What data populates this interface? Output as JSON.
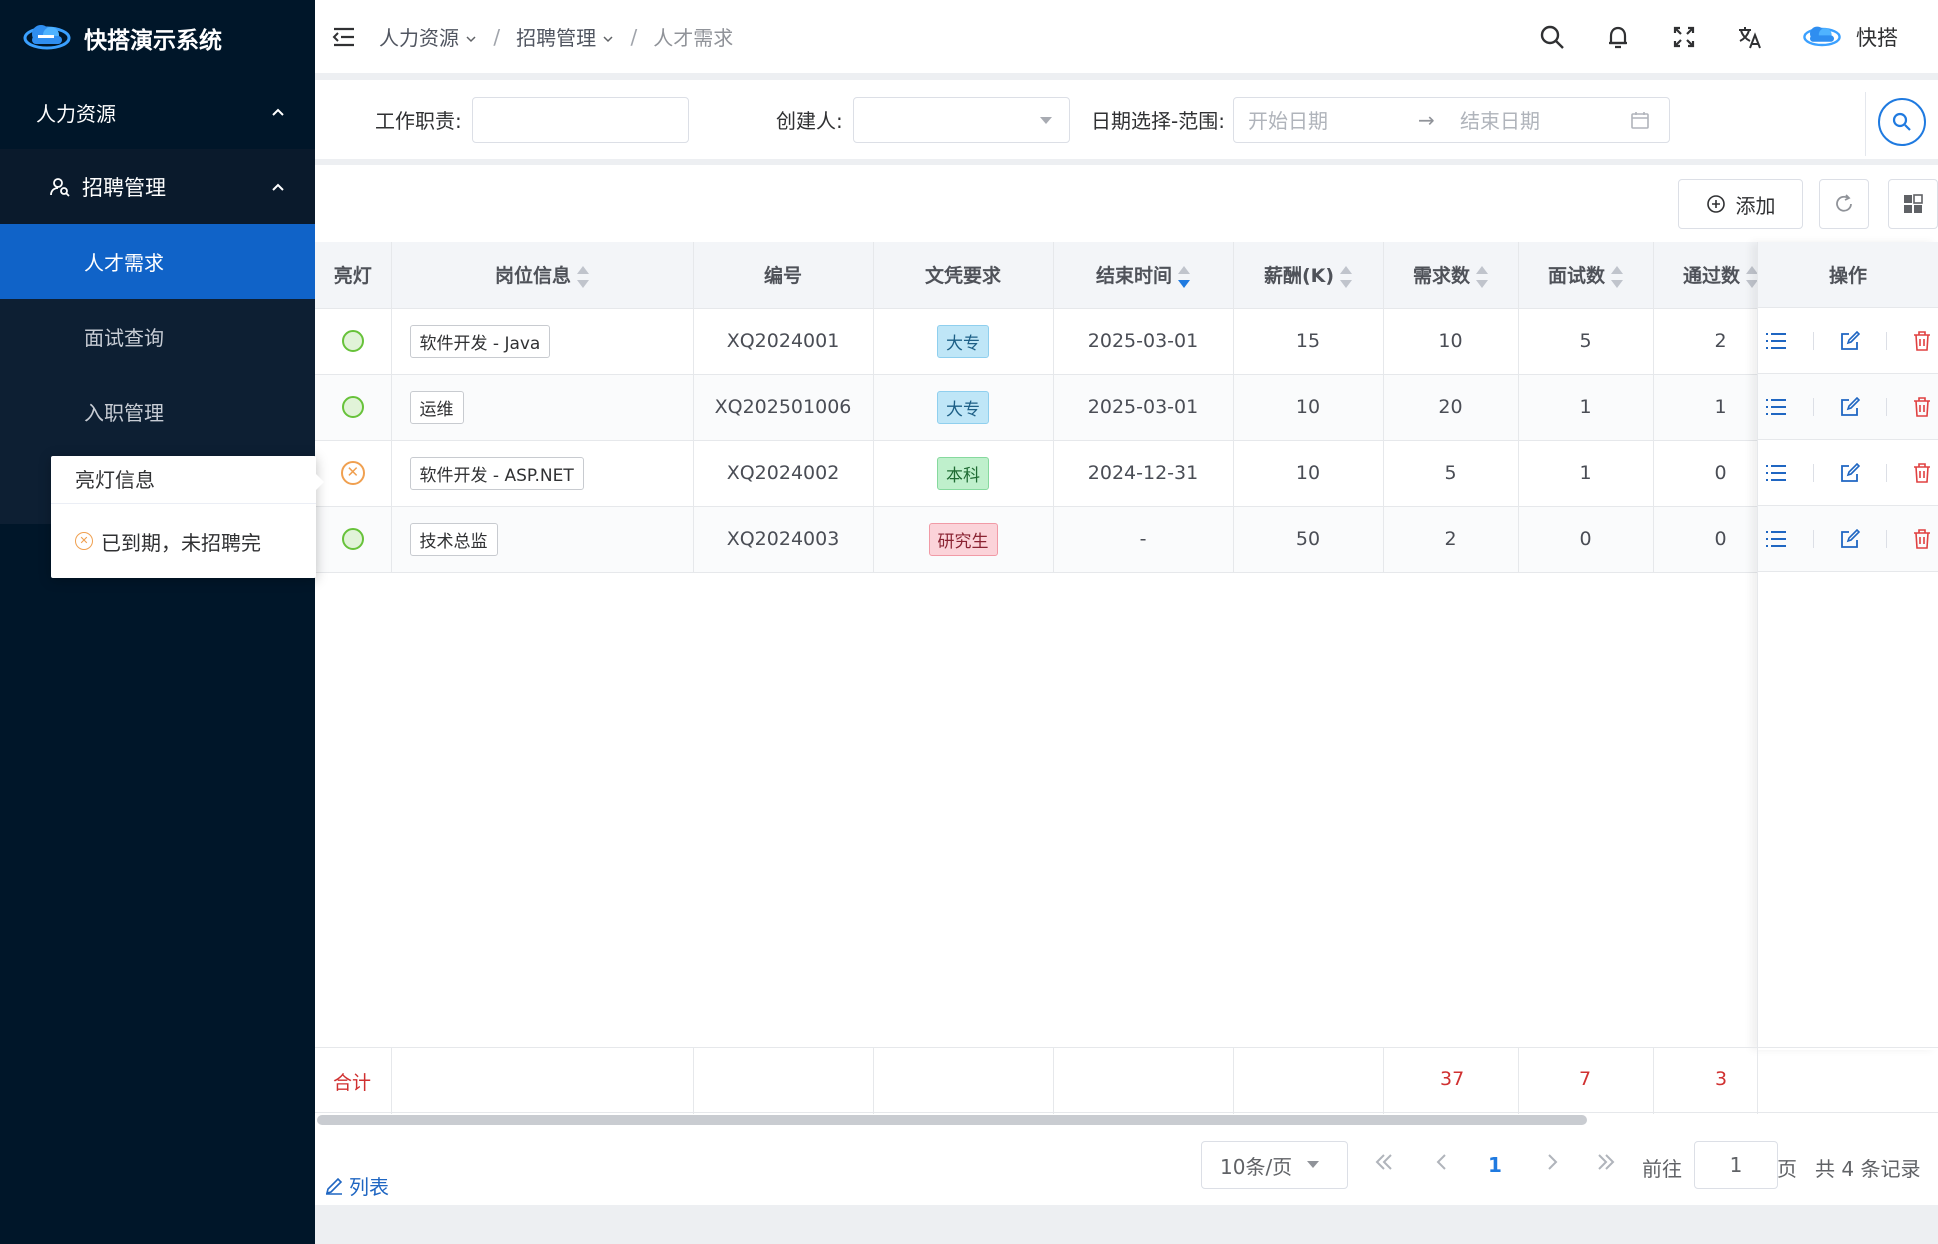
{
  "app": {
    "name": "快搭演示系统"
  },
  "sidebar": {
    "group": "人力资源",
    "submenu": "招聘管理",
    "items": [
      {
        "label": "人才需求",
        "active": true
      },
      {
        "label": "面试查询",
        "active": false
      },
      {
        "label": "入职管理",
        "active": false
      }
    ]
  },
  "breadcrumb": [
    {
      "label": "人力资源",
      "dropdown": true
    },
    {
      "label": "招聘管理",
      "dropdown": true
    },
    {
      "label": "人才需求",
      "dropdown": false
    }
  ],
  "breadcrumb_sep": "/",
  "header": {
    "user": "快搭"
  },
  "filters": {
    "duty_label": "工作职责:",
    "duty_value": "",
    "creator_label": "创建人:",
    "creator_value": "",
    "date_label": "日期选择-范围:",
    "date_start_placeholder": "开始日期",
    "date_arrow": "→",
    "date_end_placeholder": "结束日期"
  },
  "toolbar": {
    "add_label": "添加"
  },
  "table": {
    "columns": [
      "亮灯",
      "岗位信息",
      "编号",
      "文凭要求",
      "结束时间",
      "薪酬(K)",
      "需求数",
      "面试数",
      "通过数",
      "操作"
    ],
    "rows": [
      {
        "light": "ok",
        "position": "软件开发 - Java",
        "code": "XQ2024001",
        "edu": "大专",
        "end": "2025-03-01",
        "salary": "15",
        "demand": "10",
        "interview": "5",
        "passed": "2"
      },
      {
        "light": "ok",
        "position": "运维",
        "code": "XQ202501006",
        "edu": "大专",
        "end": "2025-03-01",
        "salary": "10",
        "demand": "20",
        "interview": "1",
        "passed": "1"
      },
      {
        "light": "expired",
        "position": "软件开发 - ASP.NET",
        "code": "XQ2024002",
        "edu": "本科",
        "end": "2024-12-31",
        "salary": "10",
        "demand": "5",
        "interview": "1",
        "passed": "0"
      },
      {
        "light": "ok",
        "position": "技术总监",
        "code": "XQ2024003",
        "edu": "研究生",
        "end": "-",
        "salary": "50",
        "demand": "2",
        "interview": "0",
        "passed": "0"
      }
    ],
    "edu_colors": {
      "大专": "#bfe6f7",
      "本科": "#bff0cc",
      "研究生": "#fbd3d9"
    },
    "summary": {
      "label": "合计",
      "demand": "37",
      "interview": "7",
      "passed": "3"
    }
  },
  "pagination": {
    "page_size": "10条/页",
    "current": "1",
    "goto_label": "前往",
    "goto_value": "1",
    "page_suffix": "页",
    "total": "共 4 条记录"
  },
  "footer": {
    "list_link": "列表"
  },
  "popover": {
    "title": "亮灯信息",
    "text": "已到期，未招聘完"
  },
  "colors": {
    "sidebar": "#001629",
    "accent": "#1063c8",
    "sum": "#d03030"
  }
}
